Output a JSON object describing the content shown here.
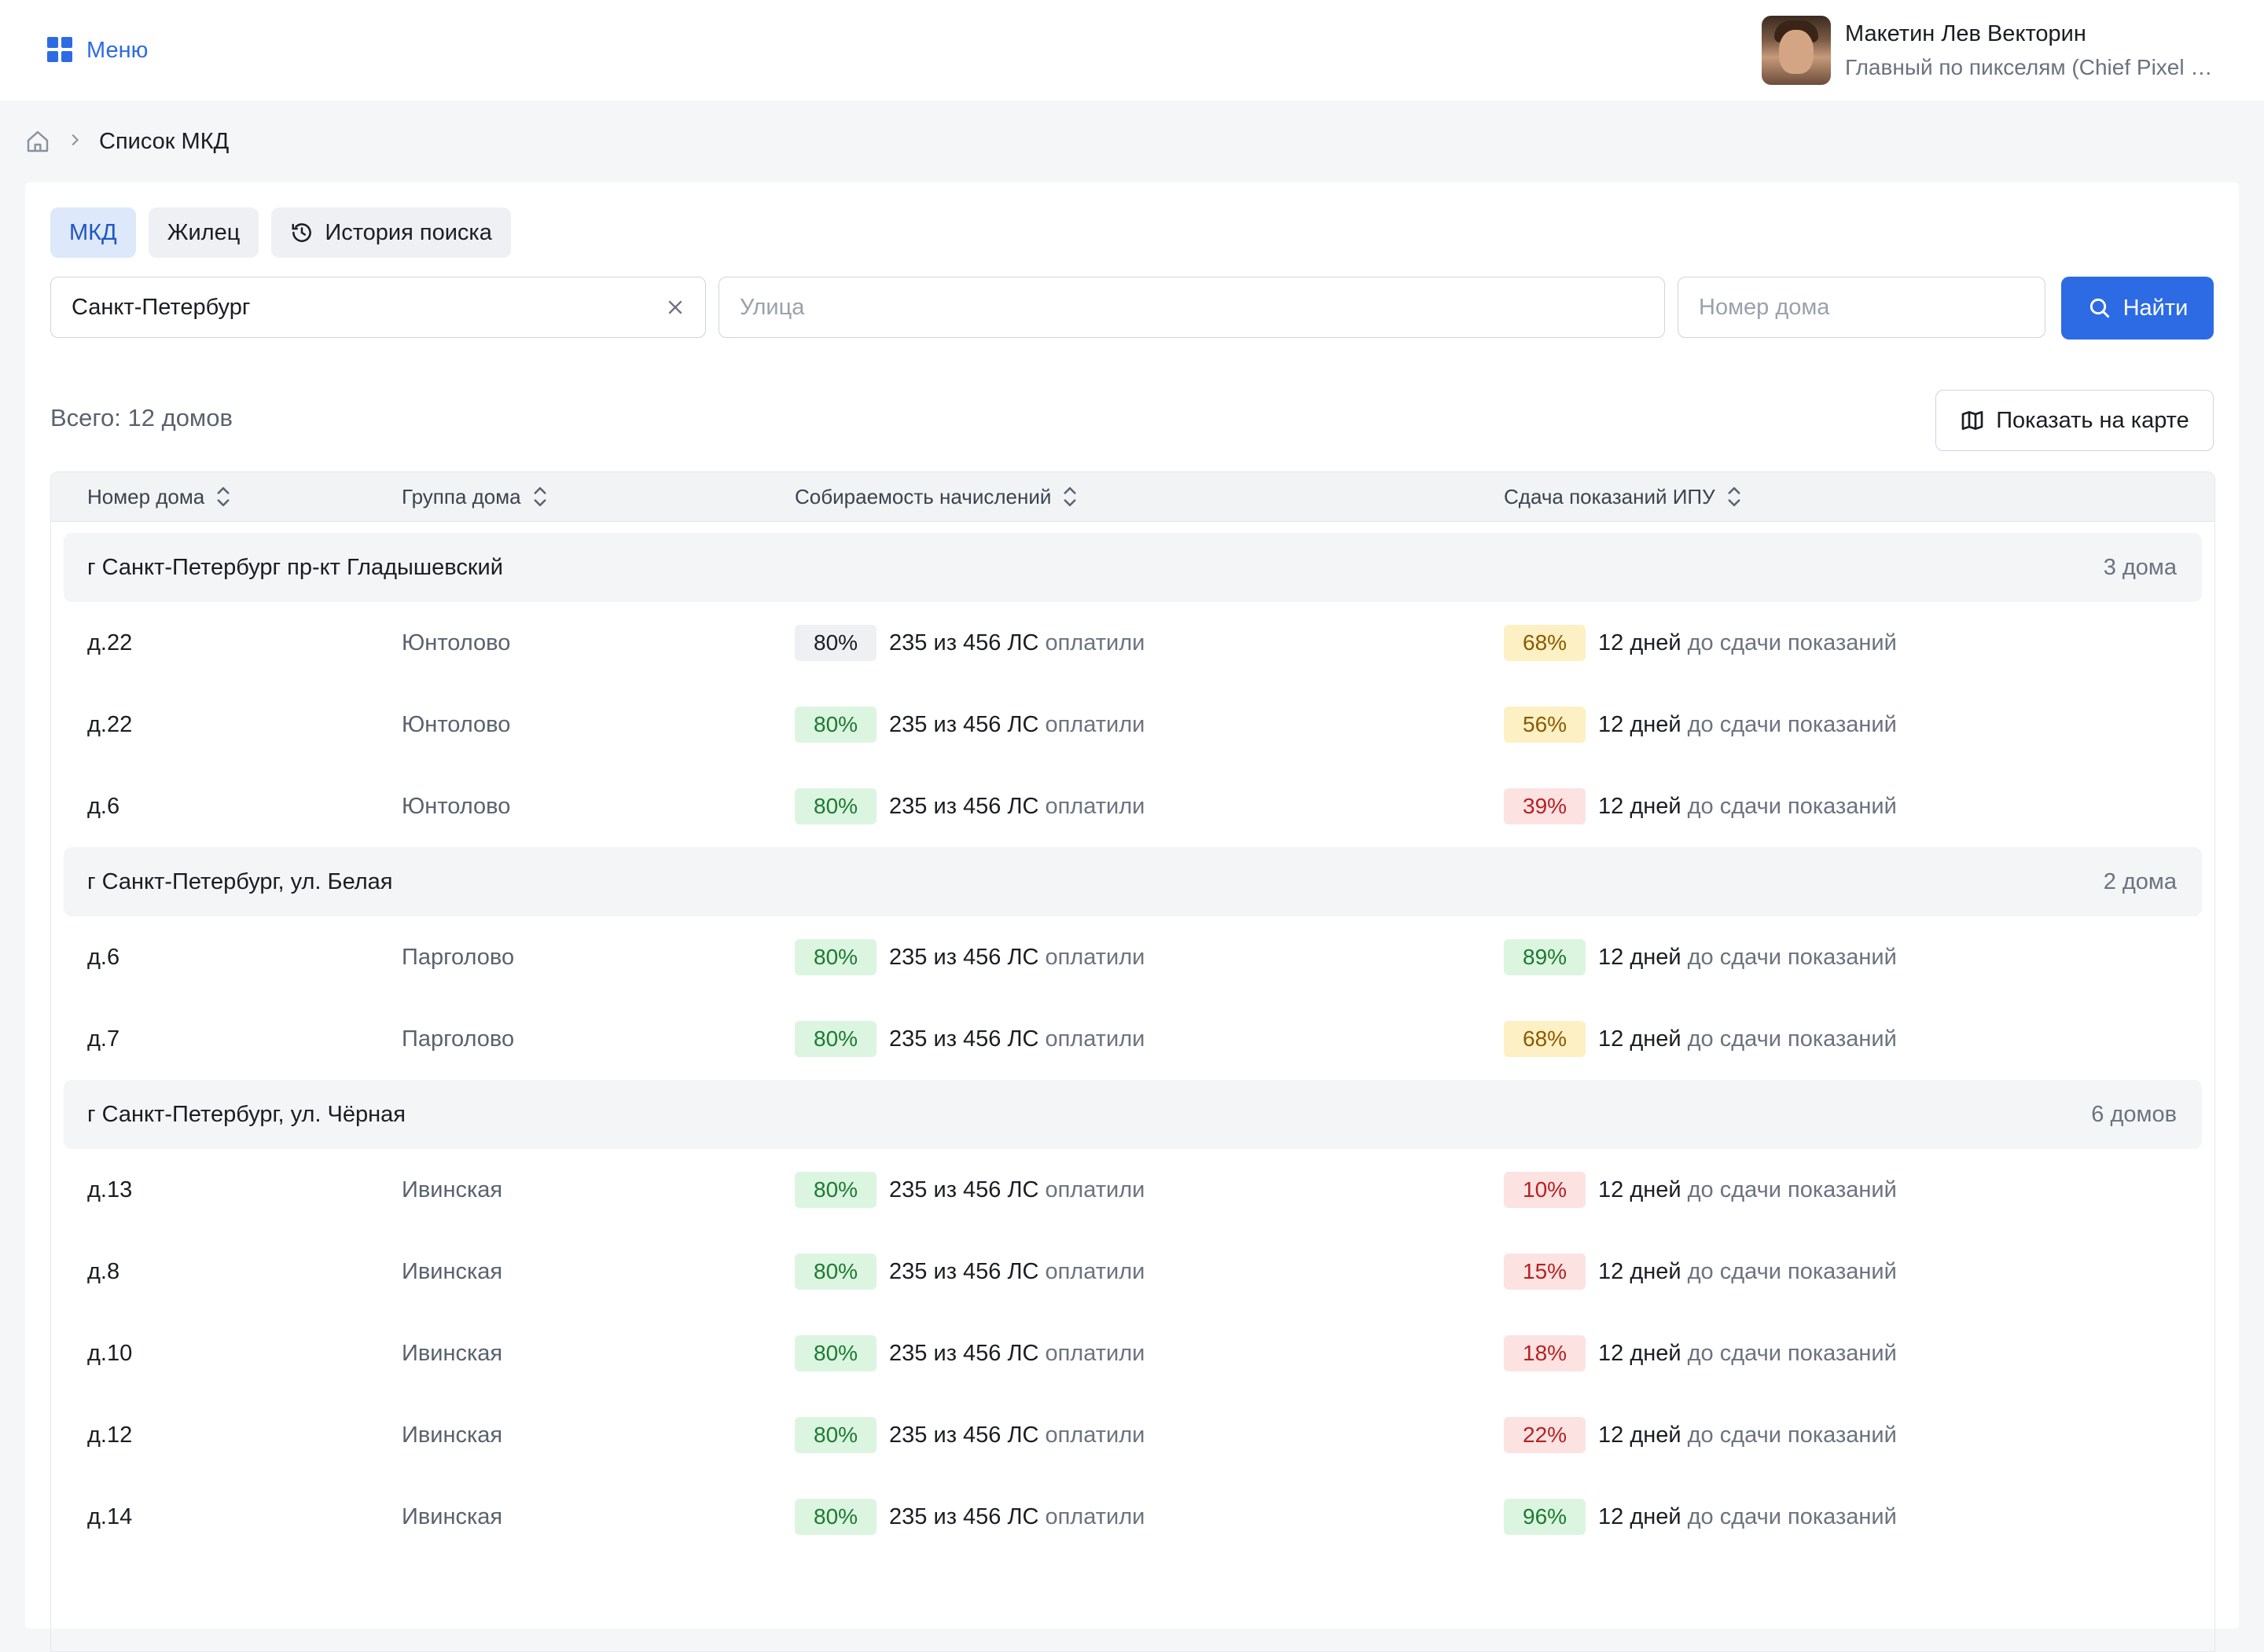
{
  "header": {
    "menu_label": "Меню",
    "user_name": "Макетин Лев Векторин",
    "user_role": "Главный по пикселям (Chief Pixel Officer)"
  },
  "breadcrumb": {
    "current": "Список МКД"
  },
  "tabs": [
    {
      "label": "МКД",
      "active": true
    },
    {
      "label": "Жилец",
      "active": false
    },
    {
      "label": "История поиска",
      "active": false,
      "icon": "history-icon"
    }
  ],
  "search": {
    "city_value": "Санкт-Петербург",
    "street_placeholder": "Улица",
    "house_placeholder": "Номер дома",
    "find_label": "Найти"
  },
  "summary": {
    "total_label": "Всего: 12 домов",
    "map_button": "Показать на карте"
  },
  "table": {
    "columns": [
      "Номер дома",
      "Группа дома",
      "Собираемость начислений",
      "Сдача показаний ИПУ"
    ],
    "paid_text": "235 из 456 ЛС",
    "paid_suffix": "оплатили",
    "days_text": "12 дней",
    "days_suffix": "до сдачи показаний",
    "groups": [
      {
        "title": "г Санкт-Петербург пр-кт Гладышевский",
        "count": "3 дома",
        "rows": [
          {
            "num": "д.22",
            "group": "Юнтолово",
            "collect": "80%",
            "collect_color": "gray",
            "ipu": "68%",
            "ipu_color": "yellow"
          },
          {
            "num": "д.22",
            "group": "Юнтолово",
            "collect": "80%",
            "collect_color": "green",
            "ipu": "56%",
            "ipu_color": "yellow"
          },
          {
            "num": "д.6",
            "group": "Юнтолово",
            "collect": "80%",
            "collect_color": "green",
            "ipu": "39%",
            "ipu_color": "red"
          }
        ]
      },
      {
        "title": "г Санкт-Петербург, ул. Белая",
        "count": "2 дома",
        "rows": [
          {
            "num": "д.6",
            "group": "Парголово",
            "collect": "80%",
            "collect_color": "green",
            "ipu": "89%",
            "ipu_color": "green"
          },
          {
            "num": "д.7",
            "group": "Парголово",
            "collect": "80%",
            "collect_color": "green",
            "ipu": "68%",
            "ipu_color": "yellow"
          }
        ]
      },
      {
        "title": "г Санкт-Петербург, ул. Чёрная",
        "count": "6 домов",
        "rows": [
          {
            "num": "д.13",
            "group": "Ивинская",
            "collect": "80%",
            "collect_color": "green",
            "ipu": "10%",
            "ipu_color": "red"
          },
          {
            "num": "д.8",
            "group": "Ивинская",
            "collect": "80%",
            "collect_color": "green",
            "ipu": "15%",
            "ipu_color": "red"
          },
          {
            "num": "д.10",
            "group": "Ивинская",
            "collect": "80%",
            "collect_color": "green",
            "ipu": "18%",
            "ipu_color": "red"
          },
          {
            "num": "д.12",
            "group": "Ивинская",
            "collect": "80%",
            "collect_color": "green",
            "ipu": "22%",
            "ipu_color": "red"
          },
          {
            "num": "д.14",
            "group": "Ивинская",
            "collect": "80%",
            "collect_color": "green",
            "ipu": "96%",
            "ipu_color": "green"
          }
        ]
      }
    ]
  },
  "colors": {
    "accent": "#2d6be4",
    "green": "#dcf5e0",
    "yellow": "#fdf0c4",
    "red": "#fde2e2"
  }
}
